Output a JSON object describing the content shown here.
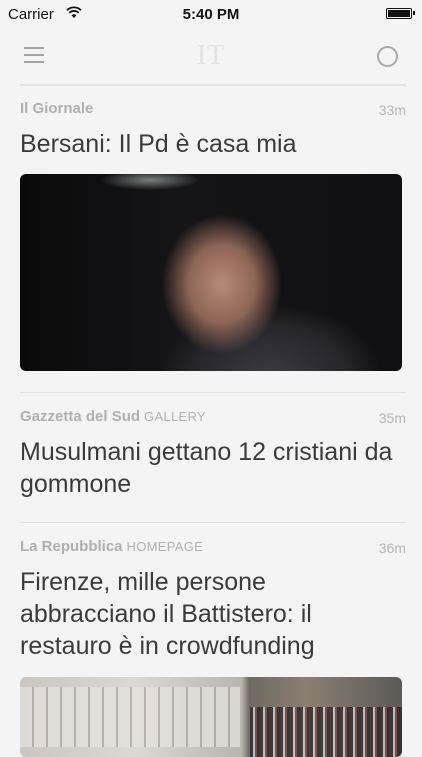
{
  "status_bar": {
    "carrier": "Carrier",
    "time": "5:40 PM"
  },
  "nav": {
    "logo": "IT",
    "menu_icon": "hamburger-menu-icon",
    "right_icon": "circle-icon"
  },
  "articles": [
    {
      "source": "Il Giornale",
      "section": "",
      "time_ago": "33m",
      "headline": "Bersani: Il Pd è casa mia"
    },
    {
      "source": "Gazzetta del Sud",
      "section": "GALLERY",
      "time_ago": "35m",
      "headline": "Musulmani gettano 12 cristiani da gommone"
    },
    {
      "source": "La Repubblica",
      "section": "HOMEPAGE",
      "time_ago": "36m",
      "headline": "Firenze, mille persone abbracciano il Battistero: il restauro è in crowdfunding"
    }
  ],
  "colors": {
    "background": "#f4f4f4",
    "source_text": "#b0b0b0",
    "headline_text": "#3b3b3b"
  }
}
